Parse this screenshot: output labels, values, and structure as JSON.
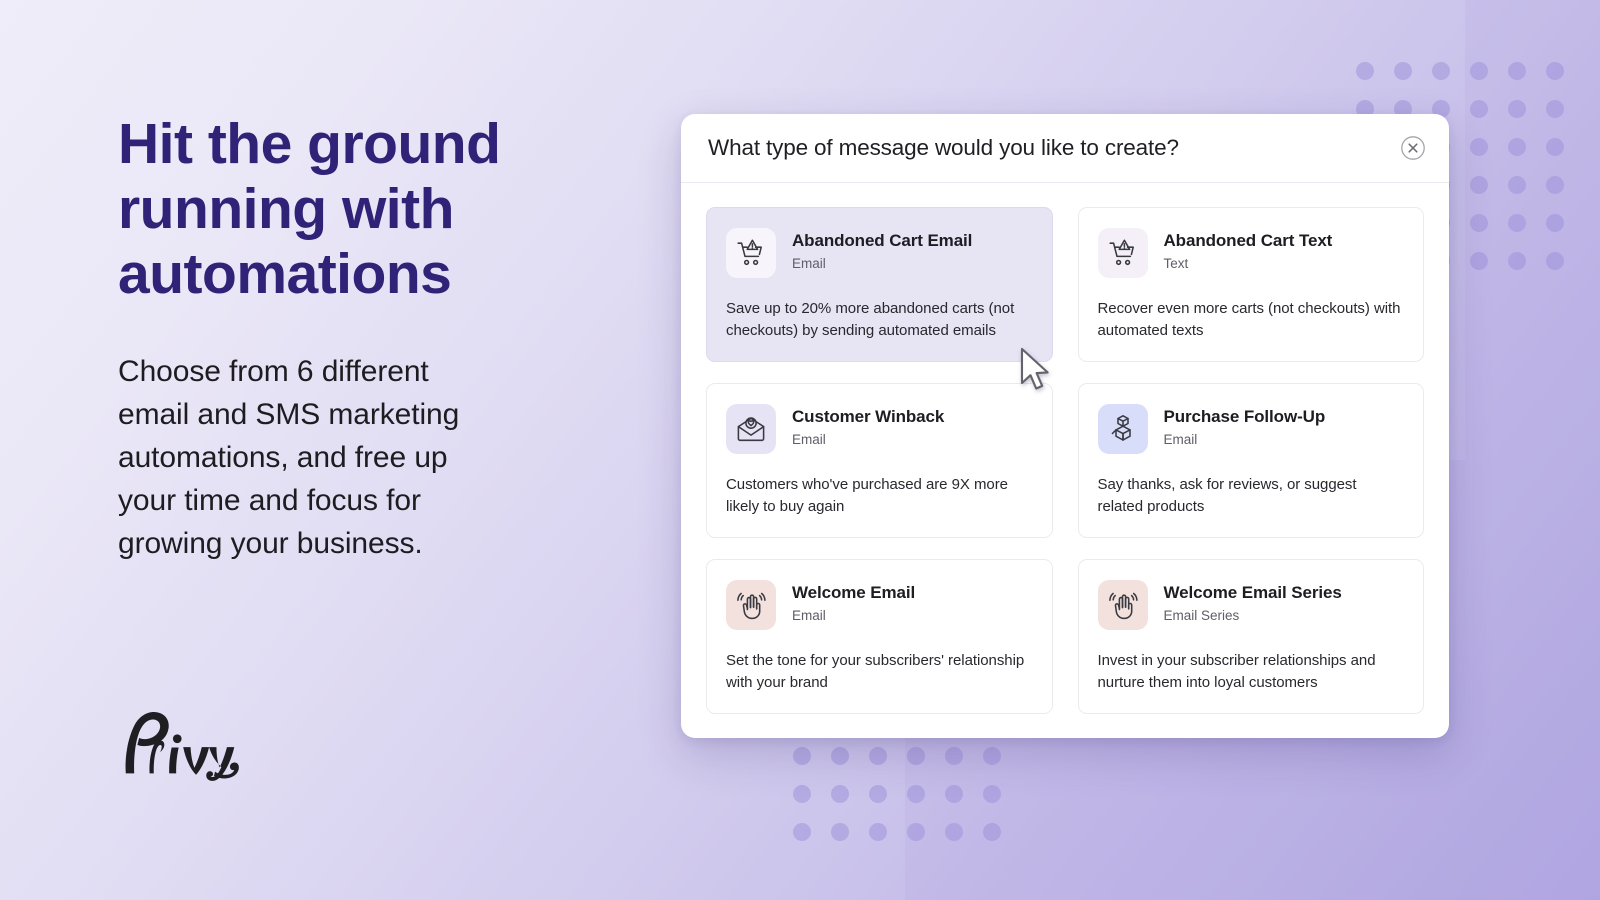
{
  "hero": {
    "headline": "Hit the ground\nrunning with\nautomations",
    "subcopy": "Choose from 6 different\nemail and SMS marketing\nautomations, and free up\nyour time and focus for\ngrowing your business.",
    "brand_name": "Privy",
    "headline_color": "#2f2277",
    "subcopy_color": "#1d1d21"
  },
  "modal": {
    "title": "What type of message would you like to create?",
    "close_label": "Close",
    "cards": [
      {
        "title": "Abandoned Cart Email",
        "subtitle": "Email",
        "description": "Save up to 20% more abandoned carts (not checkouts) by sending automated emails",
        "icon": "shopping-cart-alert-icon",
        "icon_tile_color": "#f7f5fb",
        "hovered": true
      },
      {
        "title": "Abandoned Cart Text",
        "subtitle": "Text",
        "description": "Recover even more carts (not checkouts) with automated texts",
        "icon": "shopping-cart-alert-icon",
        "icon_tile_color": "#f5eff8",
        "hovered": false
      },
      {
        "title": "Customer Winback",
        "subtitle": "Email",
        "description": "Customers who've purchased are 9X more likely to buy again",
        "icon": "envelope-heart-icon",
        "icon_tile_color": "#e6e3f4",
        "hovered": false
      },
      {
        "title": "Purchase Follow-Up",
        "subtitle": "Email",
        "description": "Say thanks, ask for reviews, or suggest related products",
        "icon": "stacked-boxes-icon",
        "icon_tile_color": "#d8defa",
        "hovered": false
      },
      {
        "title": "Welcome Email",
        "subtitle": "Email",
        "description": "Set the tone for your subscribers' relationship with your brand",
        "icon": "waving-hand-icon",
        "icon_tile_color": "#f2e1dd",
        "hovered": false
      },
      {
        "title": "Welcome Email Series",
        "subtitle": "Email Series",
        "description": "Invest in your subscriber relationships and nurture them into loyal customers",
        "icon": "waving-hand-icon",
        "icon_tile_color": "#f2e1dd",
        "hovered": false
      }
    ]
  },
  "decor": {
    "dot_color": "#9c8fda",
    "background_start": "#efedf9",
    "background_end": "#b3aae3",
    "cursor": "mouse-pointer-arrow"
  }
}
